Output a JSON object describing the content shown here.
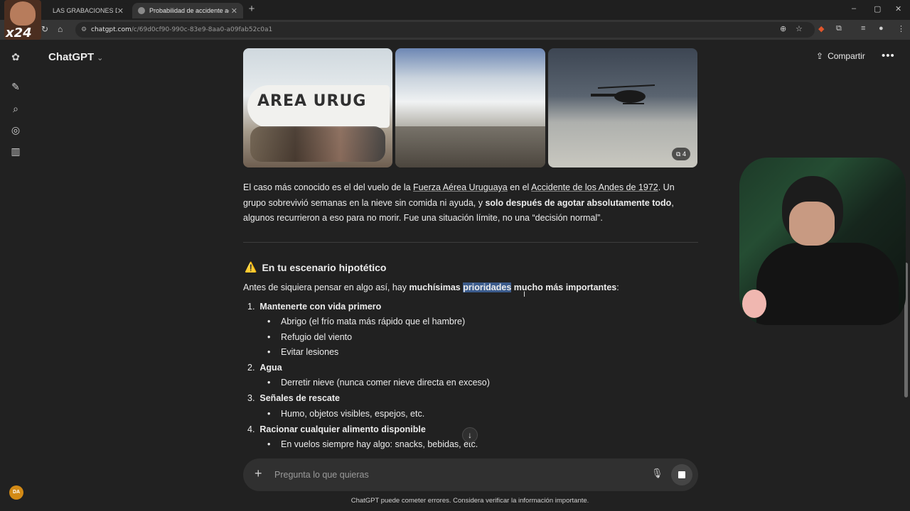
{
  "browser": {
    "tabs": [
      {
        "title": "LAS GRABACIONES DE CA",
        "active": false
      },
      {
        "title": "Probabilidad de accidente aére",
        "active": true
      }
    ],
    "url_host": "chatgpt.com",
    "url_path": "/c/69d0cf90-990c-83e9-8aa0-a09fab52c0a1"
  },
  "overlay": {
    "badge": "x24"
  },
  "header": {
    "model_label": "ChatGPT",
    "share_label": "Compartir"
  },
  "images": {
    "plane_text": "AREA URUG",
    "count": "4"
  },
  "message": {
    "p1_a": "El caso más conocido es el del vuelo de la ",
    "p1_link1": "Fuerza Aérea Uruguaya",
    "p1_b": " en el ",
    "p1_link2": "Accidente de los Andes de 1972",
    "p1_c": ". Un grupo sobrevivió semanas en la nieve sin comida ni ayuda, y ",
    "p1_bold": "solo después de agotar absolutamente todo",
    "p1_d": ", algunos recurrieron a eso para no morir. Fue una situación límite, no una “decisión normal”.",
    "heading_icon": "⚠️",
    "heading": "En tu escenario hipotético",
    "intro_a": "Antes de siquiera pensar en algo así, hay ",
    "intro_bold1": "muchísimas ",
    "intro_highlight": "prioridades",
    "intro_bold2": " mucho más importantes",
    "intro_end": ":",
    "list": [
      {
        "num": "1.",
        "title": "Mantenerte con vida primero",
        "items": [
          "Abrigo (el frío mata más rápido que el hambre)",
          "Refugio del viento",
          "Evitar lesiones"
        ]
      },
      {
        "num": "2.",
        "title": "Agua",
        "items": [
          "Derretir nieve (nunca comer nieve directa en exceso)"
        ]
      },
      {
        "num": "3.",
        "title": "Señales de rescate",
        "items": [
          "Humo, objetos visibles, espejos, etc."
        ]
      },
      {
        "num": "4.",
        "title": "Racionar cualquier alimento disponible",
        "items": [
          "En vuelos siempre hay algo: snacks, bebidas, etc."
        ]
      }
    ]
  },
  "composer": {
    "placeholder": "Pregunta lo que quieras"
  },
  "disclaimer": "ChatGPT puede cometer errores. Considera verificar la información importante.",
  "user": {
    "initials": "DA"
  }
}
